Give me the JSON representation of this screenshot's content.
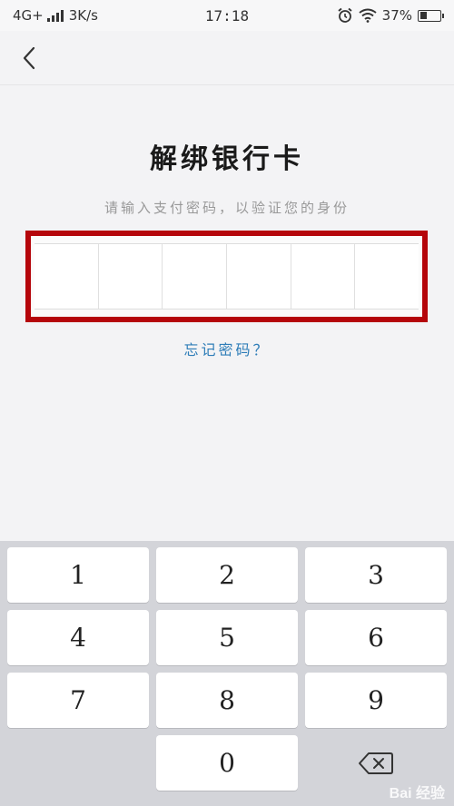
{
  "status_bar": {
    "network": "4G+",
    "speed": "3K/s",
    "time": "17:18",
    "battery": "37%",
    "battery_level": 0.37
  },
  "nav": {
    "back_icon": "chevron-left-icon"
  },
  "title": "解绑银行卡",
  "subtitle": "请输入支付密码，以验证您的身份",
  "pin": {
    "length": 6
  },
  "forgot_password": "忘记密码？",
  "keypad": {
    "keys": [
      "1",
      "2",
      "3",
      "4",
      "5",
      "6",
      "7",
      "8",
      "9",
      "0"
    ],
    "delete_icon": "backspace-icon"
  },
  "watermark": "Bai 经验",
  "colors": {
    "highlight_border": "#b5060b",
    "link": "#2e7db8",
    "keypad_bg": "#d3d4d9"
  }
}
